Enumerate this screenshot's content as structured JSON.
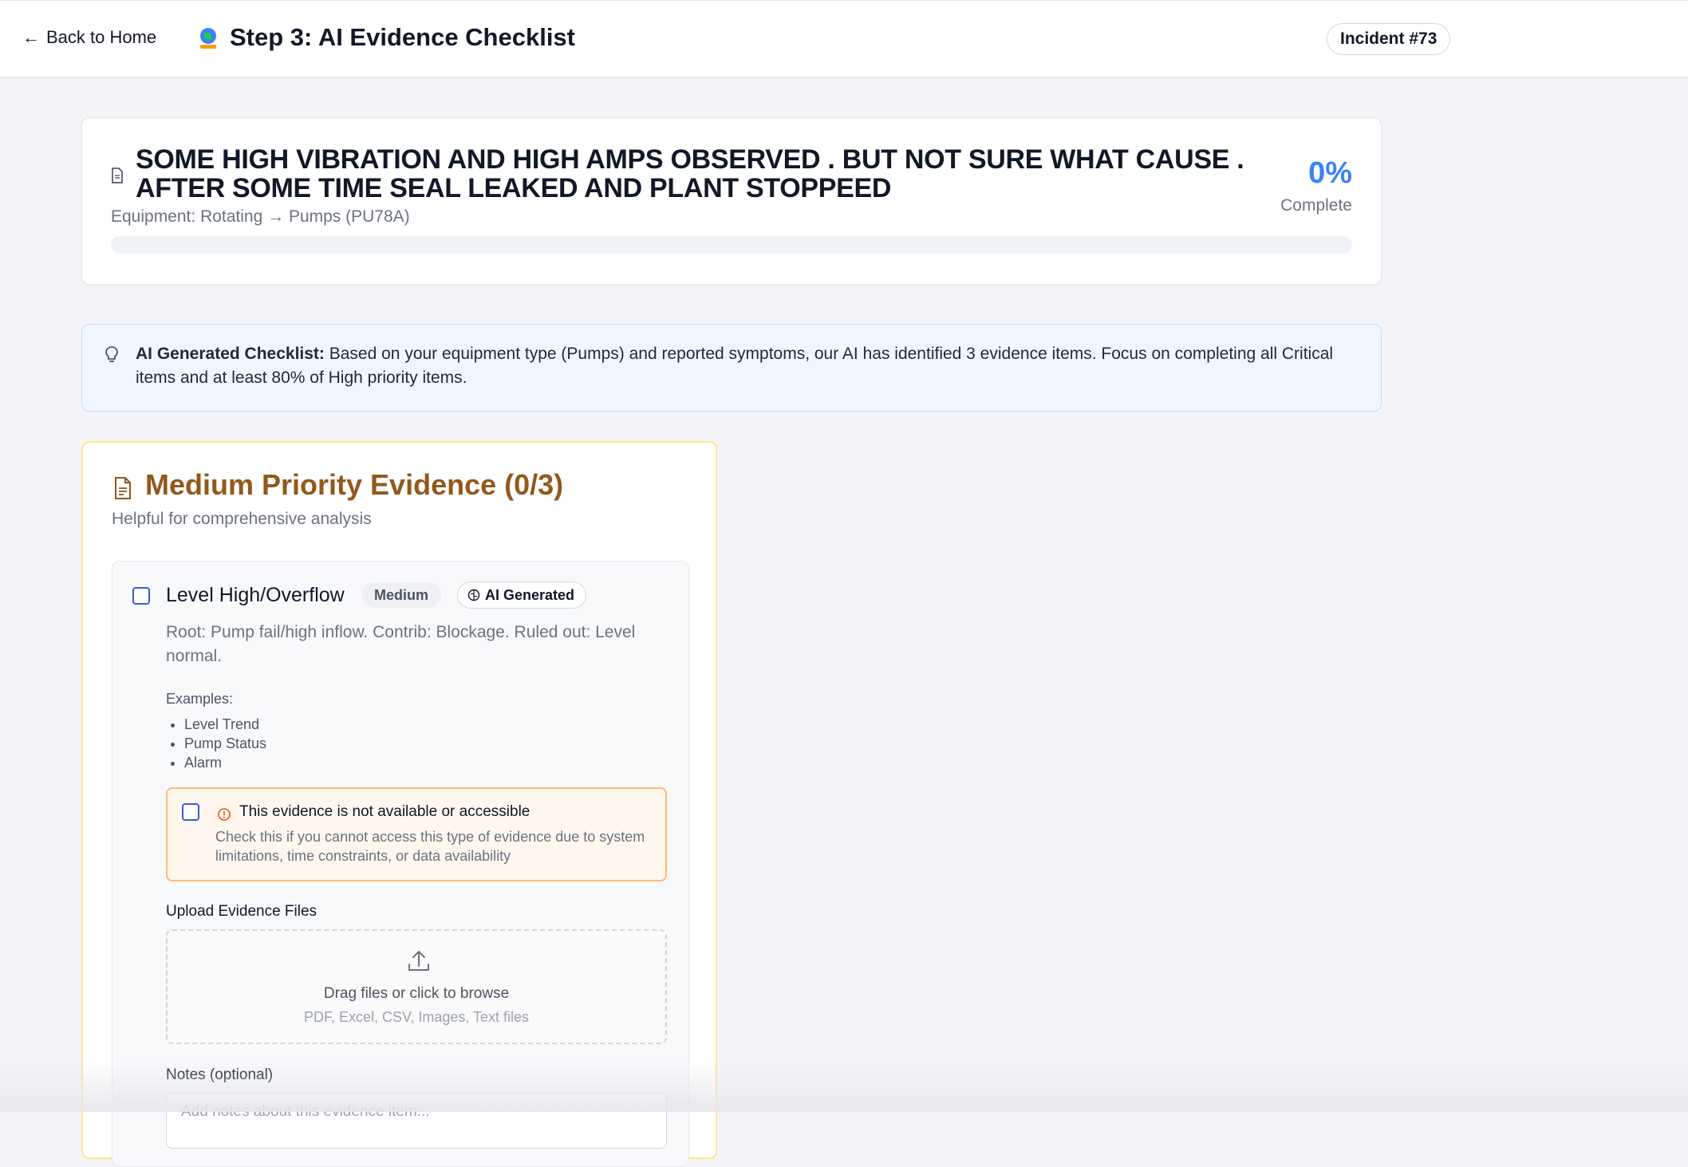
{
  "header": {
    "back_label": "Back to Home",
    "title": "Step 3: AI Evidence Checklist",
    "incident_badge": "Incident #73"
  },
  "summary": {
    "incident_title": "SOME HIGH VIBRATION AND HIGH AMPS OBSERVED . BUT NOT SURE WHAT CAUSE . AFTER SOME TIME SEAL LEAKED AND PLANT STOPPEED",
    "equipment": "Equipment: Rotating → Pumps (PU78A)",
    "percent": "0%",
    "percent_label": "Complete",
    "progress_fraction": 0
  },
  "info": {
    "lead": "AI Generated Checklist:",
    "text": " Based on your equipment type (Pumps) and reported symptoms, our AI has identified 3 evidence items. Focus on completing all Critical items and at least 80% of High priority items."
  },
  "priority_section": {
    "title": "Medium Priority Evidence (0/3)",
    "subtitle": "Helpful for comprehensive analysis",
    "items": [
      {
        "title": "Level High/Overflow",
        "priority_tag": "Medium",
        "ai_tag": "AI Generated",
        "description": "Root: Pump fail/high inflow. Contrib: Blockage. Ruled out: Level normal.",
        "examples_label": "Examples:",
        "examples": [
          "Level Trend",
          "Pump Status",
          "Alarm"
        ],
        "not_available_title": "This evidence is not available or accessible",
        "not_available_desc": "Check this if you cannot access this type of evidence due to system limitations, time constraints, or data availability",
        "upload_label": "Upload Evidence Files",
        "drop_main": "Drag files or click to browse",
        "drop_sub": "PDF, Excel, CSV, Images, Text files",
        "notes_label": "Notes (optional)",
        "notes_placeholder": "Add notes about this evidence item..."
      }
    ]
  },
  "colors": {
    "accent": "#3b82f6",
    "priority_medium": "#92581c",
    "warning_border": "#fdba74"
  }
}
